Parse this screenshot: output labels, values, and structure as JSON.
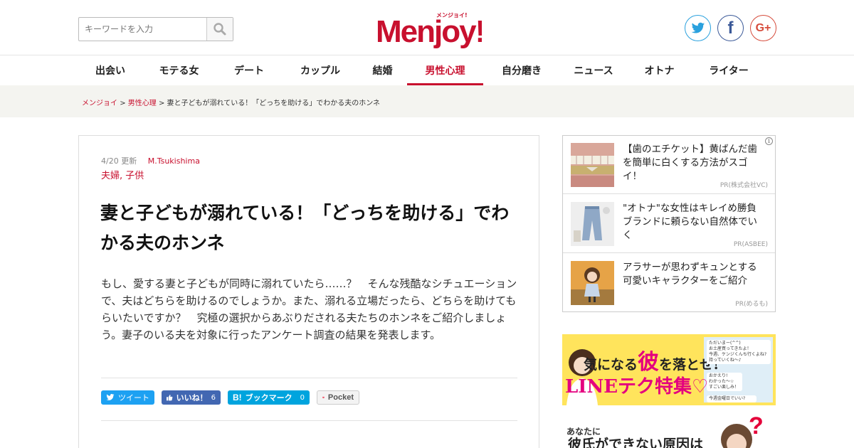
{
  "search": {
    "placeholder": "キーワードを入力"
  },
  "logo": {
    "text": "Menjoy!",
    "tagline": "メンジョイ!"
  },
  "social": {
    "twitter": "twitter-icon",
    "facebook": "facebook-icon",
    "googleplus": "google-plus-icon",
    "gplus_label": "G+",
    "fb_label": "f"
  },
  "nav": {
    "items": [
      "出会い",
      "モテる女",
      "デート",
      "カップル",
      "結婚",
      "男性心理",
      "自分磨き",
      "ニュース",
      "オトナ",
      "ライター"
    ],
    "active_index": 5
  },
  "breadcrumb": {
    "home": "メンジョイ",
    "category": "男性心理",
    "current": "妻と子どもが溺れている！「どっちを助ける」でわかる夫のホンネ",
    "separator": ">"
  },
  "article": {
    "date": "4/20 更新",
    "author": "M.Tsukishima",
    "tags": "夫婦, 子供",
    "title": "妻と子どもが溺れている！「どっちを助ける」でわかる夫のホンネ",
    "lead": "もし、愛する妻と子どもが同時に溺れていたら……？　そんな残酷なシチュエーションで、夫はどちらを助けるのでしょうか。また、溺れる立場だったら、どちらを助けてもらいたいですか？　究極の選択からあぶりだされる夫たちのホンネをご紹介しましょう。妻子のいる夫を対象に行ったアンケート調査の結果を発表します。"
  },
  "share": {
    "tweet": "ツイート",
    "like": "いいね！",
    "like_count": "6",
    "hatena": "ブックマーク",
    "hatena_prefix": "B!",
    "hatena_count": "0",
    "pocket": "Pocket"
  },
  "ads": [
    {
      "text": "【歯のエチケット】黄ばんだ歯を簡単に白くする方法がスゴイ！",
      "pr": "PR(株式会社VC)"
    },
    {
      "text": "\"オトナ\"な女性はキレイめ勝負ブランドに頼らない自然体でいく",
      "pr": "PR(ASBEE)"
    },
    {
      "text": "アラサーが思わずキュンとする可愛いキャラクターをご紹介",
      "pr": "PR(めるも)"
    }
  ],
  "ad_info_icon": "i",
  "banner1": {
    "line1_a": "気になる",
    "line1_b": "彼",
    "line1_c": "を落とせ!",
    "line2": "LINEテク特集♡",
    "chat1": "ただいまー(^^)",
    "chat2": "お土産買ってきたよ！",
    "chat3": "今週、ケンジくんち行くよね?持っていくね〜♪",
    "chat4": "おかえり!",
    "chat5": "わかった〜☆",
    "chat6": "すごい楽しみ！",
    "chat7": "今週金曜日でいい?"
  },
  "banner2": {
    "line1": "あなたに",
    "line2": "彼氏ができない原因は",
    "q": "?"
  },
  "colors": {
    "brand": "#c8102e",
    "twitter": "#1da1f2",
    "facebook": "#4267b2",
    "hatena": "#00a4de"
  }
}
